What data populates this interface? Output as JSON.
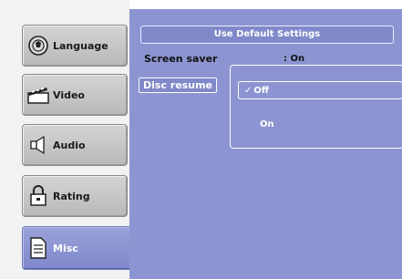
{
  "tabs": [
    {
      "label": "Language",
      "icon": "language-icon"
    },
    {
      "label": "Video",
      "icon": "video-clapper-icon"
    },
    {
      "label": "Audio",
      "icon": "speaker-icon"
    },
    {
      "label": "Rating",
      "icon": "lock-icon"
    },
    {
      "label": "Misc",
      "icon": "document-icon",
      "active": true
    }
  ],
  "panel": {
    "header": "Use Default Settings",
    "rows": [
      {
        "label": "Screen saver",
        "value": ": On"
      },
      {
        "label": "Disc resume",
        "selected": true
      }
    ]
  },
  "popup": {
    "options": [
      {
        "label": "Off",
        "checked": true,
        "check_mark": "✓"
      },
      {
        "label": "On",
        "checked": false
      }
    ]
  },
  "colors": {
    "panel": "#8c95d1",
    "tab": "#c6c6c6",
    "active_tab": "#8a93d2"
  }
}
